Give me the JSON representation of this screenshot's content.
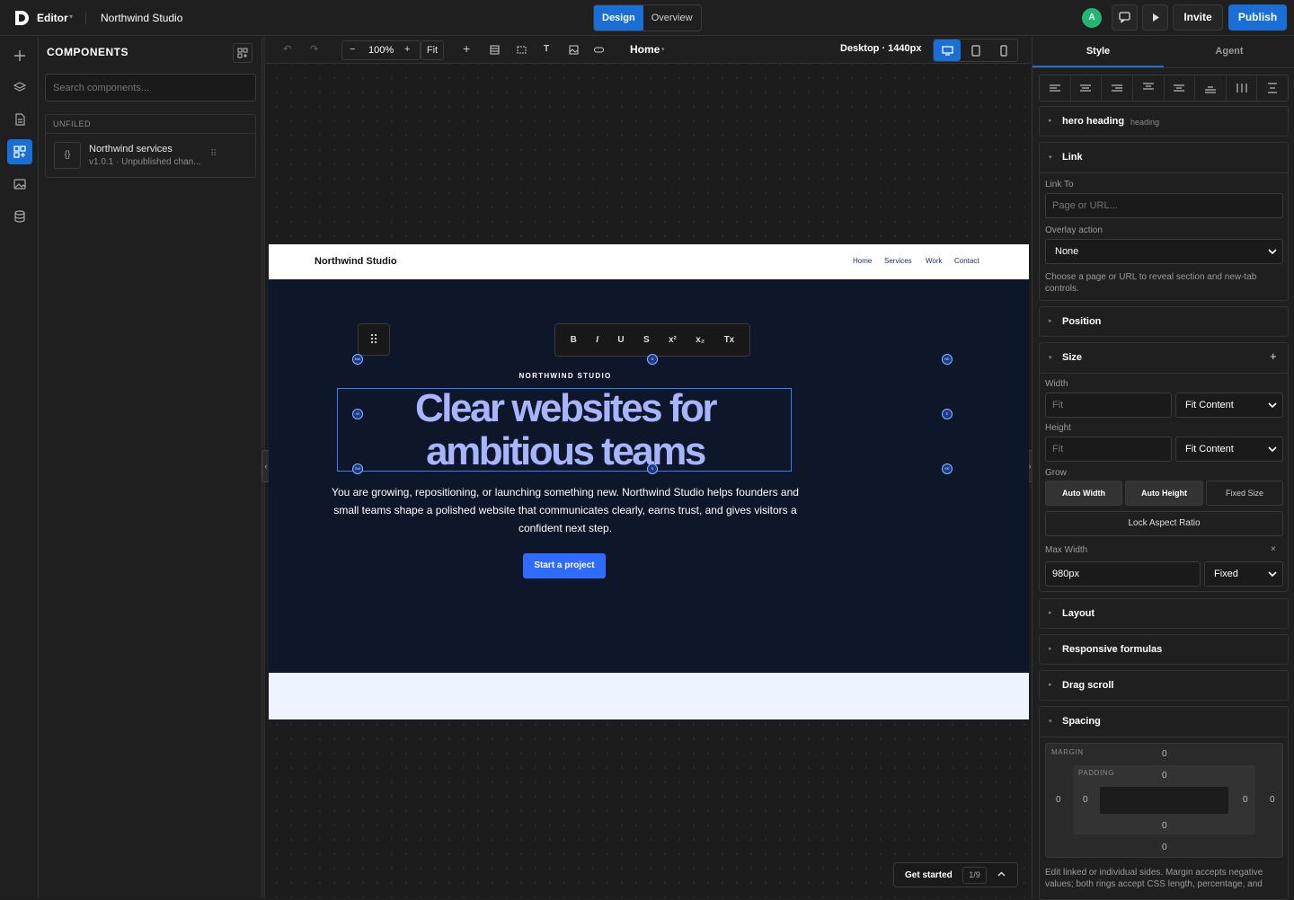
{
  "topbar": {
    "app": "Editor",
    "project": "Northwind Studio",
    "modes": [
      "Design",
      "Overview"
    ],
    "avatar": "A",
    "invite": "Invite",
    "publish": "Publish"
  },
  "components": {
    "title": "COMPONENTS",
    "search_placeholder": "Search components...",
    "group_label": "UNFILED",
    "item_name": "Northwind services",
    "item_meta": "v1.0.1 · Unpublished chan...",
    "item_icon": "{}"
  },
  "canvas_toolbar": {
    "zoom": "100%",
    "fit": "Fit",
    "page": "Home",
    "breakpoint": "Desktop · 1440px"
  },
  "site": {
    "brand": "Northwind Studio",
    "nav": [
      "Home",
      "Services",
      "Work",
      "Contact"
    ],
    "eyebrow": "NORTHWIND STUDIO",
    "headline_l1": "Clear websites for",
    "headline_l2": "ambitious teams",
    "body": "You are growing, repositioning, or launching something new. Northwind Studio helps founders and small teams shape a polished website that communicates clearly, earns trust, and gives visitors a confident next step.",
    "cta": "Start a project"
  },
  "format_bar": [
    "B",
    "I",
    "U",
    "S",
    "x²",
    "x₂",
    "Tx"
  ],
  "handles": {
    "nw": "NW",
    "n": "N",
    "ne": "NE",
    "w": "W",
    "e": "E",
    "sw": "SW",
    "s": "S",
    "se": "SE"
  },
  "get_started": {
    "label": "Get started",
    "progress": "1/9"
  },
  "panel": {
    "tabs": [
      "Style",
      "Agent"
    ],
    "element_name": "hero heading",
    "element_type": "heading",
    "link": {
      "title": "Link",
      "link_to_label": "Link To",
      "link_to_placeholder": "Page or URL...",
      "overlay_label": "Overlay action",
      "overlay_value": "None",
      "help": "Choose a page or URL to reveal section and new-tab controls."
    },
    "position": "Position",
    "size": {
      "title": "Size",
      "plus": "+",
      "width_label": "Width",
      "width_placeholder": "Fit",
      "width_mode": "Fit Content",
      "height_label": "Height",
      "height_placeholder": "Fit",
      "height_mode": "Fit Content",
      "grow_label": "Grow",
      "grow_options": [
        "Auto Width",
        "Auto Height",
        "Fixed Size"
      ],
      "lock": "Lock Aspect Ratio",
      "max_width_label": "Max Width",
      "max_width_clear": "×",
      "max_width_value": "980px",
      "max_width_mode": "Fixed"
    },
    "layout": "Layout",
    "responsive": "Responsive formulas",
    "drag_scroll": "Drag scroll",
    "spacing": {
      "title": "Spacing",
      "margin_label": "MARGIN",
      "padding_label": "PADDING",
      "margin": {
        "top": "0",
        "right": "0",
        "bottom": "0",
        "left": "0"
      },
      "padding": {
        "top": "0",
        "right": "0",
        "bottom": "0",
        "left": "0"
      },
      "help": "Edit linked or individual sides. Margin accepts negative values; both rings accept CSS length, percentage, and"
    }
  }
}
